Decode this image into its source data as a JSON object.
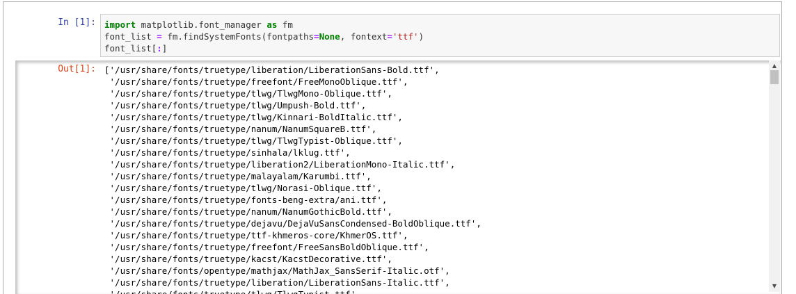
{
  "input_cell": {
    "prompt": "In [1]:",
    "code_lines": [
      [
        {
          "t": "import",
          "c": "kw"
        },
        {
          "t": " matplotlib.font_manager ",
          "c": ""
        },
        {
          "t": "as",
          "c": "kw"
        },
        {
          "t": " fm",
          "c": ""
        }
      ],
      [
        {
          "t": "font_list ",
          "c": ""
        },
        {
          "t": "=",
          "c": "op"
        },
        {
          "t": " fm.findSystemFonts(fontpaths",
          "c": ""
        },
        {
          "t": "=",
          "c": "op"
        },
        {
          "t": "None",
          "c": "kw"
        },
        {
          "t": ", fontext",
          "c": ""
        },
        {
          "t": "=",
          "c": "op"
        },
        {
          "t": "'ttf'",
          "c": "str"
        },
        {
          "t": ")",
          "c": ""
        }
      ],
      [
        {
          "t": "font_list[",
          "c": ""
        },
        {
          "t": ":",
          "c": "op"
        },
        {
          "t": "]",
          "c": ""
        }
      ]
    ]
  },
  "output_cell": {
    "prompt": "Out[1]:",
    "lines": [
      "['/usr/share/fonts/truetype/liberation/LiberationSans-Bold.ttf',",
      " '/usr/share/fonts/truetype/freefont/FreeMonoOblique.ttf',",
      " '/usr/share/fonts/truetype/tlwg/TlwgMono-Oblique.ttf',",
      " '/usr/share/fonts/truetype/tlwg/Umpush-Bold.ttf',",
      " '/usr/share/fonts/truetype/tlwg/Kinnari-BoldItalic.ttf',",
      " '/usr/share/fonts/truetype/nanum/NanumSquareB.ttf',",
      " '/usr/share/fonts/truetype/tlwg/TlwgTypist-Oblique.ttf',",
      " '/usr/share/fonts/truetype/sinhala/lklug.ttf',",
      " '/usr/share/fonts/truetype/liberation2/LiberationMono-Italic.ttf',",
      " '/usr/share/fonts/truetype/malayalam/Karumbi.ttf',",
      " '/usr/share/fonts/truetype/tlwg/Norasi-Oblique.ttf',",
      " '/usr/share/fonts/truetype/fonts-beng-extra/ani.ttf',",
      " '/usr/share/fonts/truetype/nanum/NanumGothicBold.ttf',",
      " '/usr/share/fonts/truetype/dejavu/DejaVuSansCondensed-BoldOblique.ttf',",
      " '/usr/share/fonts/truetype/ttf-khmeros-core/KhmerOS.ttf',",
      " '/usr/share/fonts/truetype/freefont/FreeSansBoldOblique.ttf',",
      " '/usr/share/fonts/truetype/kacst/KacstDecorative.ttf',",
      " '/usr/share/fonts/opentype/mathjax/MathJax_SansSerif-Italic.otf',",
      " '/usr/share/fonts/truetype/liberation/LiberationSans-Italic.ttf',",
      " '/usr/share/fonts/truetype/tlwg/TlwgTypist.ttf',"
    ]
  },
  "scrollbar": {
    "up_icon": "▲",
    "down_icon": "▼"
  },
  "colors": {
    "input_prompt": "#303f9f",
    "output_prompt": "#d84315",
    "keyword": "#008000",
    "operator": "#aa22ff",
    "string": "#ba2121"
  }
}
